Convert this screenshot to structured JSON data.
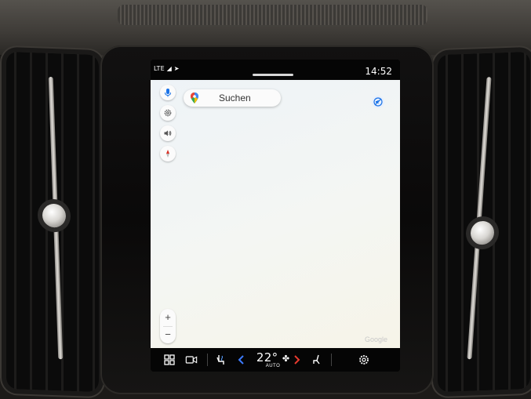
{
  "statusbar": {
    "signal": "LTE ◢ ➤",
    "time": "14:52"
  },
  "map": {
    "search_label": "Suchen",
    "zoom_in": "+",
    "zoom_out": "−",
    "attribution": "Google"
  },
  "climate": {
    "temperature": "22°",
    "mode": "AUTO"
  },
  "icons": {
    "mic": "microphone-icon",
    "gear": "settings-icon",
    "volume": "volume-icon",
    "compass": "compass-icon",
    "mute": "mute-icon",
    "apps": "app-grid-icon",
    "camera": "camera-icon",
    "seat_heat": "seat-heat-icon",
    "fan": "fan-icon",
    "seat": "seat-icon",
    "settings_bar": "gear-icon"
  },
  "colors": {
    "accent_blue": "#1a73e8",
    "arrow_left": "#3d7bff",
    "arrow_right": "#e83a2e",
    "compass_red": "#d93025"
  }
}
